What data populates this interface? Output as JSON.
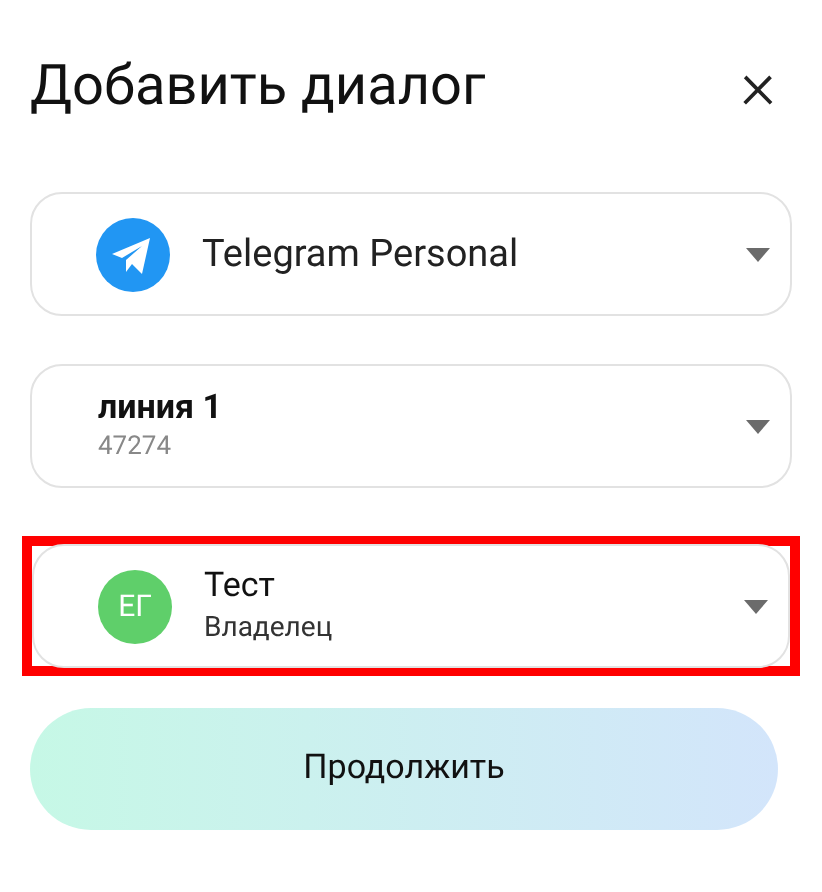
{
  "dialog": {
    "title": "Добавить диалог",
    "close": "×"
  },
  "selects": [
    {
      "kind": "channel",
      "label": "Telegram Personal",
      "highlighted": false
    },
    {
      "kind": "line",
      "label": "линия 1",
      "sublabel": "47274",
      "highlighted": false
    },
    {
      "kind": "user",
      "initials": "ЕГ",
      "label": "Тест",
      "sublabel": "Владелец",
      "color": "#5fcf6a",
      "highlighted": true
    }
  ],
  "continue_button": "Продолжить"
}
